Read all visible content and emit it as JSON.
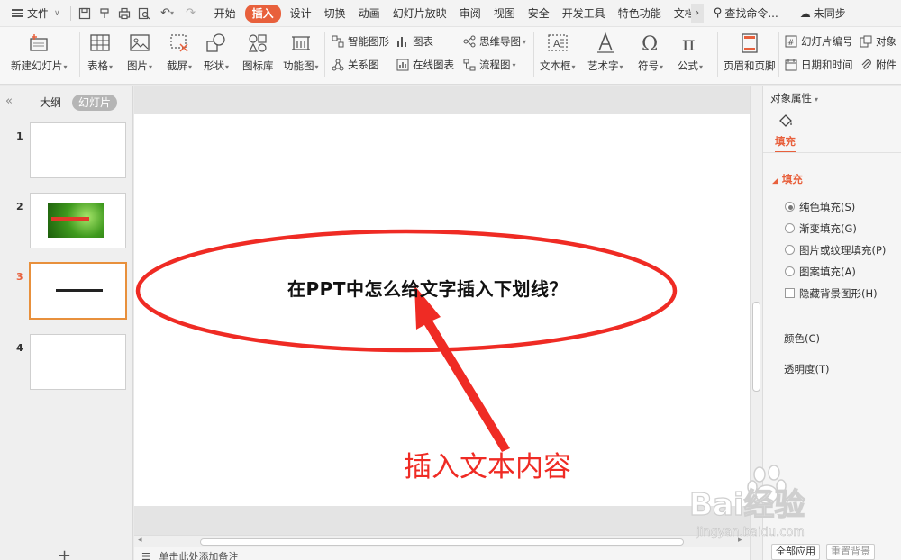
{
  "menubar": {
    "file": "文件",
    "tabs": [
      "开始",
      "插入",
      "设计",
      "切换",
      "动画",
      "幻灯片放映",
      "审阅",
      "视图",
      "安全",
      "开发工具",
      "特色功能",
      "文档"
    ],
    "active_tab": "插入",
    "search": "查找命令...",
    "sync": "未同步"
  },
  "ribbon": {
    "new_slide": "新建幻灯片",
    "table": "表格",
    "picture": "图片",
    "screenshot": "截屏",
    "shapes": "形状",
    "icon_library": "图标库",
    "function_chart": "功能图",
    "smart_graphic": "智能图形",
    "chart": "图表",
    "mind_map": "思维导图",
    "relation_chart": "关系图",
    "online_chart": "在线图表",
    "flowchart": "流程图",
    "textbox": "文本框",
    "wordart": "艺术字",
    "symbol": "符号",
    "formula": "公式",
    "header_footer": "页眉和页脚",
    "slide_number": "幻灯片编号",
    "object": "对象",
    "date_time": "日期和时间",
    "attachment": "附件"
  },
  "leftpanel": {
    "tab_outline": "大纲",
    "tab_slides": "幻灯片",
    "thumbnails": [
      {
        "num": "1"
      },
      {
        "num": "2"
      },
      {
        "num": "3"
      },
      {
        "num": "4"
      }
    ]
  },
  "slide": {
    "title": "在PPT中怎么给文字插入下划线？",
    "annotation": "插入文本内容",
    "annotation_color": "#ef2b24"
  },
  "notes": "单击此处添加备注",
  "rightpanel": {
    "header": "对象属性",
    "tab_fill": "填充",
    "section_fill": "填充",
    "solid_fill": "纯色填充(S)",
    "gradient_fill": "渐变填充(G)",
    "picture_fill": "图片或纹理填充(P)",
    "pattern_fill": "图案填充(A)",
    "hide_bg": "隐藏背景图形(H)",
    "color": "颜色(C)",
    "transparency": "透明度(T)",
    "apply_all": "全部应用",
    "reset_bg": "重置背景"
  },
  "watermark": {
    "brand": "Bai经验",
    "url": "jingyan.baidu.com"
  },
  "colors": {
    "accent": "#e8603c",
    "annotation_red": "#ef2b24"
  }
}
